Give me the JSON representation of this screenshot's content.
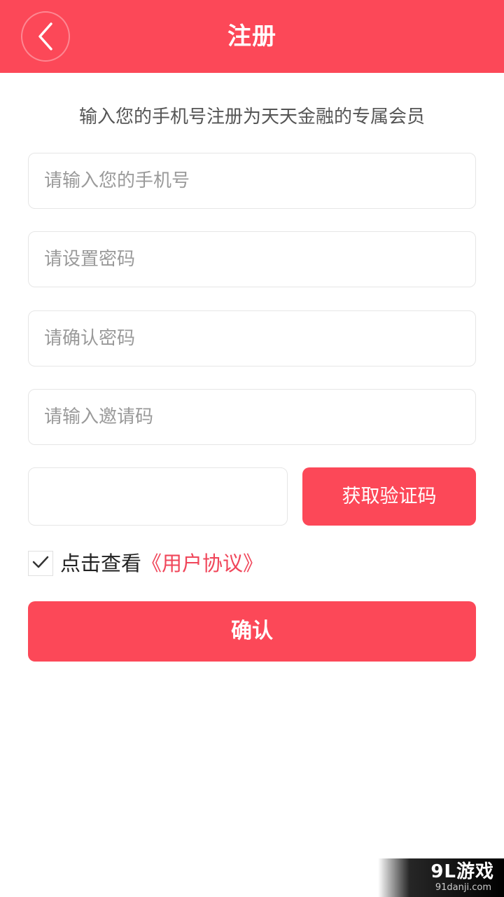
{
  "header": {
    "title": "注册"
  },
  "subtitle": "输入您的手机号注册为天天金融的专属会员",
  "form": {
    "phone_placeholder": "请输入您的手机号",
    "password_placeholder": "请设置密码",
    "confirm_password_placeholder": "请确认密码",
    "invite_code_placeholder": "请输入邀请码",
    "verification_code_value": "",
    "get_code_label": "获取验证码"
  },
  "agreement": {
    "checked": true,
    "prefix": "点击查看",
    "link": "《用户协议》"
  },
  "confirm_label": "确认",
  "watermark": {
    "main": "9L游戏",
    "sub": "91danji.com"
  },
  "colors": {
    "accent": "#fc4858",
    "link": "#f0465a"
  },
  "icons": {
    "back": "chevron-left-icon",
    "checkmark": "checkmark-icon"
  }
}
